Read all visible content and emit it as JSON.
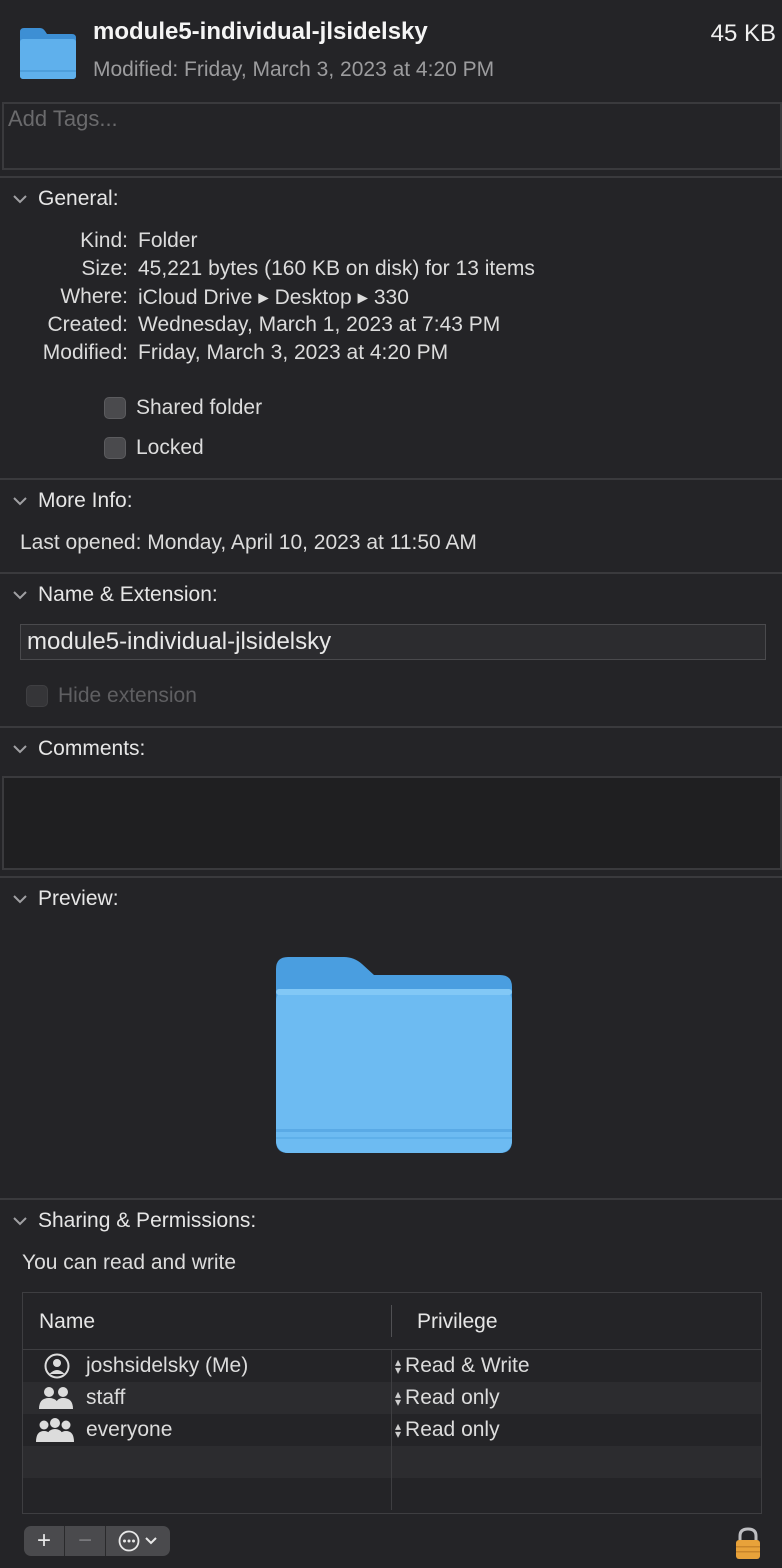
{
  "header": {
    "title": "module5-individual-jlsidelsky",
    "modified": "Modified: Friday, March 3, 2023 at 4:20 PM",
    "size": "45 KB",
    "icon": "folder-icon",
    "tags_placeholder": "Add Tags..."
  },
  "general": {
    "heading": "General:",
    "rows": [
      {
        "label": "Kind:",
        "value": "Folder"
      },
      {
        "label": "Size:",
        "value": "45,221 bytes (160 KB on disk) for 13 items"
      },
      {
        "label": "Where:",
        "value": "iCloud Drive ▸ Desktop ▸ 330"
      },
      {
        "label": "Created:",
        "value": "Wednesday, March 1, 2023 at 7:43 PM"
      },
      {
        "label": "Modified:",
        "value": "Friday, March 3, 2023 at 4:20 PM"
      }
    ],
    "shared_folder": "Shared folder",
    "locked": "Locked"
  },
  "more_info": {
    "heading": "More Info:",
    "last_opened": "Last opened: Monday, April 10, 2023 at 11:50 AM"
  },
  "name_ext": {
    "heading": "Name & Extension:",
    "name_value": "module5-individual-jlsidelsky",
    "hide_extension": "Hide extension"
  },
  "comments": {
    "heading": "Comments:"
  },
  "preview": {
    "heading": "Preview:"
  },
  "sharing": {
    "heading": "Sharing & Permissions:",
    "status": "You can read and write",
    "col_name": "Name",
    "col_privilege": "Privilege",
    "rows": [
      {
        "name": "joshsidelsky (Me)",
        "privilege": "Read & Write",
        "icon": "user-icon"
      },
      {
        "name": "staff",
        "privilege": "Read only",
        "icon": "group-icon"
      },
      {
        "name": "everyone",
        "privilege": "Read only",
        "icon": "everyone-icon"
      }
    ]
  },
  "toolbar": {
    "add": "+",
    "remove": "−",
    "actions": "⋯"
  },
  "colors": {
    "background": "#242427",
    "folder_blue": "#5fb0ec",
    "lock_gold": "#e8a23a"
  }
}
